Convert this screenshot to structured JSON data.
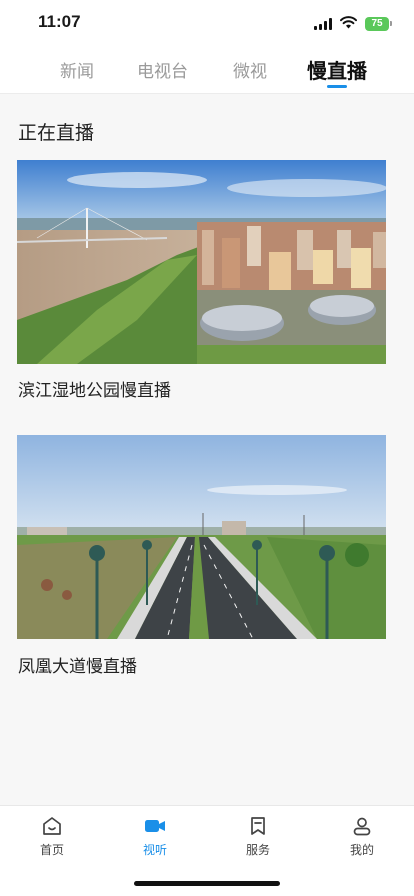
{
  "status_bar": {
    "time": "11:07",
    "battery": "75"
  },
  "top_tabs": [
    {
      "label": "新闻",
      "active": false
    },
    {
      "label": "电视台",
      "active": false
    },
    {
      "label": "微视",
      "active": false
    },
    {
      "label": "慢直播",
      "active": true
    }
  ],
  "section": {
    "title": "正在直播"
  },
  "streams": [
    {
      "title": "滨江湿地公园慢直播"
    },
    {
      "title": "凤凰大道慢直播"
    }
  ],
  "bottom_nav": [
    {
      "label": "首页",
      "icon": "home-icon",
      "active": false
    },
    {
      "label": "视听",
      "icon": "video-icon",
      "active": true
    },
    {
      "label": "服务",
      "icon": "bookmark-icon",
      "active": false
    },
    {
      "label": "我的",
      "icon": "user-icon",
      "active": false
    }
  ],
  "colors": {
    "accent": "#1a8fe8",
    "battery": "#5ac85a"
  }
}
